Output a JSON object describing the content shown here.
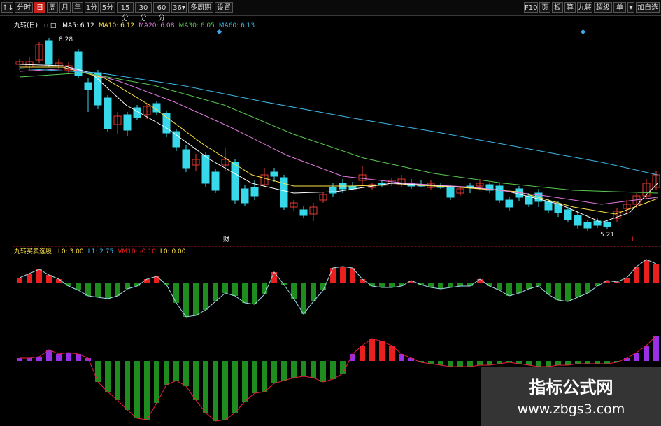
{
  "toolbar": {
    "left": [
      "↑↓",
      "分时",
      "日",
      "周",
      "月",
      "年",
      "1分",
      "5分",
      "15分",
      "30分",
      "60分",
      "36▾",
      "多周期",
      "设置"
    ],
    "active_index": 2,
    "right": [
      "F10",
      "页",
      "板",
      "算",
      "九转",
      "超级",
      "单",
      "▾",
      "加自选"
    ]
  },
  "main_legend": {
    "name": "九转(日)",
    "items": [
      {
        "label": "MA5",
        "value": "6.12",
        "color": "#ffffff"
      },
      {
        "label": "MA10",
        "value": "6.12",
        "color": "#ffe44a"
      },
      {
        "label": "MA20",
        "value": "6.08",
        "color": "#e27ae0"
      },
      {
        "label": "MA30",
        "value": "6.05",
        "color": "#59c94f"
      },
      {
        "label": "MA60",
        "value": "6.13",
        "color": "#3fb8e8"
      }
    ]
  },
  "price_labels": {
    "high": "8.28",
    "low": "5.21"
  },
  "markers": {
    "cai": "财",
    "L": "L"
  },
  "indicator": {
    "name": "九转买卖选股",
    "items": [
      {
        "label": "L0",
        "value": "3.00",
        "color": "#ffe44a"
      },
      {
        "label": "L1",
        "value": "2.75",
        "color": "#3fb8e8"
      },
      {
        "label": "VM10",
        "value": "-0.10",
        "color": "#e22"
      },
      {
        "label": "L0",
        "value": "0.00",
        "color": "#ffe44a"
      }
    ]
  },
  "colors": {
    "up": "#e8392f",
    "down": "#36d8ea",
    "green_bar": "#1e8c1e",
    "purple_bar": "#9a2fe8",
    "red_bar": "#e82020"
  },
  "watermark": {
    "title": "指标公式网",
    "url": "www.zbgs3.com"
  }
}
